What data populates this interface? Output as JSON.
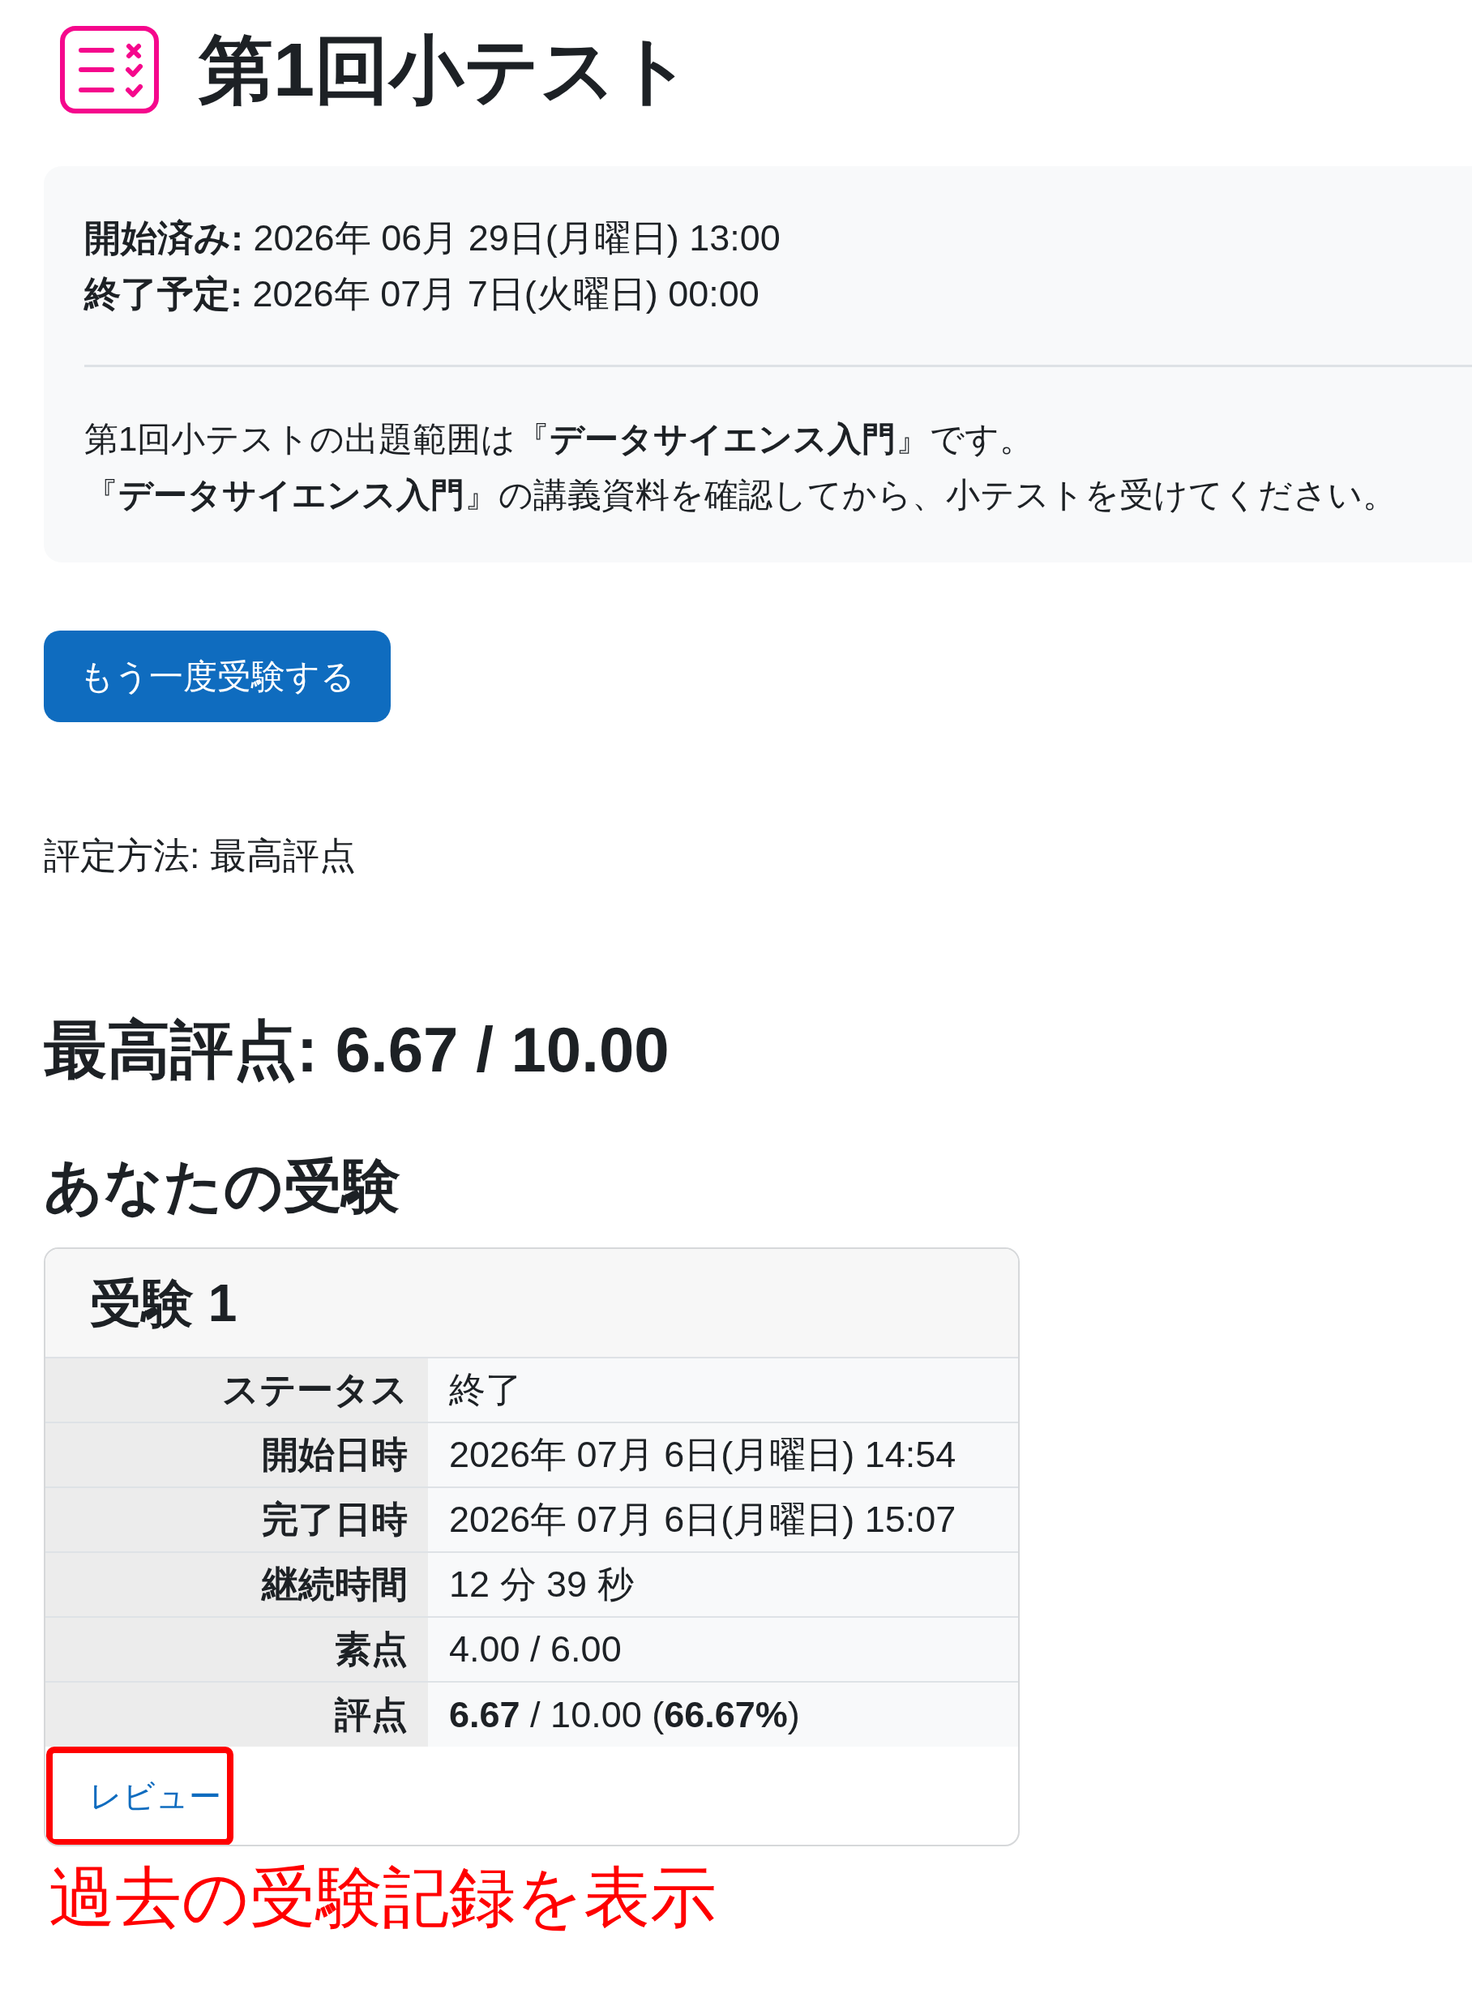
{
  "activity": {
    "title": "第1回小テスト"
  },
  "dates": [
    {
      "label": "開始済み:",
      "value": "2026年 06月 29日(月曜日) 13:00"
    },
    {
      "label": "終了予定:",
      "value": "2026年 07月 7日(火曜日) 00:00"
    }
  ],
  "description": [
    "第1回小テストの出題範囲は『**データサイエンス入門**』です。",
    "『**データサイエンス入門**』の講義資料を確認してから、小テストを受けてください。"
  ],
  "reattempt_button": {
    "label": "もう一度受験する"
  },
  "grading_method": "評定方法: 最高評点",
  "best_grade": "最高評点: 6.67 / 10.00",
  "attempts_heading": "あなたの受験",
  "attempts": [
    {
      "title": "受験 1",
      "rows": [
        {
          "label": "ステータス",
          "value": "終了"
        },
        {
          "label": "開始日時",
          "value": "2026年 07月 6日(月曜日) 14:54"
        },
        {
          "label": "完了日時",
          "value": "2026年 07月 6日(月曜日) 15:07"
        },
        {
          "label": "継続時間",
          "value": "12 分 39 秒"
        },
        {
          "label": "素点",
          "value": "4.00 / 6.00"
        },
        {
          "label": "評点",
          "value": "**6.67** / 10.00 (**66.67%**)"
        }
      ],
      "review_link": {
        "label": "レビュー",
        "highlighted": true
      }
    }
  ],
  "annotation": {
    "text": "過去の受験記録を表示"
  }
}
